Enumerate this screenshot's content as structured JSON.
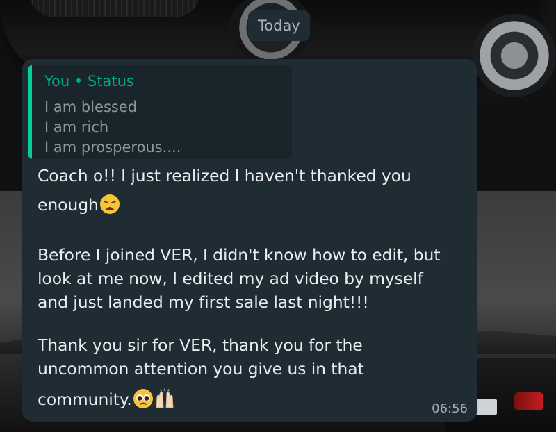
{
  "date_chip": "Today",
  "quoted_status": {
    "author": "You • Status",
    "lines": [
      "I am blessed",
      "I am rich",
      "I am prosperous...."
    ]
  },
  "message": {
    "lines": [
      "Coach o!! I just realized I haven't thanked you",
      "enough",
      "Before I joined VER, I didn't know how to edit, but",
      "look at me now, I edited my ad video by myself",
      "and just landed my first sale last night!!!",
      "Thank you sir for VER, thank you for the",
      "uncommon attention you give us in that",
      "community."
    ],
    "emojis": {
      "line2": "weary-face-icon",
      "line8": [
        "pleading-face-icon",
        "raising-hands-icon"
      ]
    },
    "time": "06:56"
  },
  "colors": {
    "bubble": "#1f2c33",
    "quote_bar": "#06cf9c",
    "quote_author": "#00a884",
    "text": "#e9edef"
  }
}
